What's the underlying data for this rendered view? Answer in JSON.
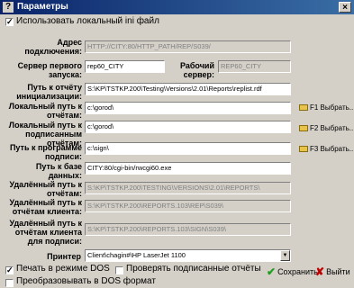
{
  "window": {
    "title": "Параметры",
    "close": "×",
    "app_icon": "?"
  },
  "use_ini": {
    "label": "Использовать локальный ini файл",
    "checked": true
  },
  "fields": {
    "address": {
      "label": "Адрес подключения:",
      "value": "HTTP://CITY:80/HTTP_PATH/REP/S039/"
    },
    "server_first": {
      "label": "Сервер первого запуска:",
      "value": "rep60_CITY"
    },
    "work_server": {
      "label": "Рабочий сервер:",
      "value": "REP60_CITY"
    },
    "init_path": {
      "label": "Путь к отчёту инициализации:",
      "value": "S:\\KP\\TSTKP.200\\Testing\\Versions\\2.01\\Reports\\replist.rdf"
    },
    "local_reports": {
      "label": "Локальный путь к отчётам:",
      "value": "c:\\gorod\\",
      "browse": "F1 Выбрать..."
    },
    "local_signed": {
      "label": "Локальный путь к подписанным отчётам:",
      "value": "c:\\gorod\\",
      "browse": "F2 Выбрать..."
    },
    "sign_program": {
      "label": "Путь к программе подписи:",
      "value": "c:\\sign\\",
      "browse": "F3 Выбрать..."
    },
    "db_path": {
      "label": "Путь к базе данных:",
      "value": "CITY:80/cgi-bin/rwcgi60.exe"
    },
    "remote_reports": {
      "label": "Удалённый путь к отчётам:",
      "value": "S:\\KP\\TSTKP.200\\TESTING\\VERSIONS\\2.01\\REPORTS\\"
    },
    "remote_client": {
      "label": "Удалённый путь к отчётам клиента:",
      "value": "S:\\KP\\TSTKP.200\\REPORTS.103\\REP\\S039\\"
    },
    "remote_client_sign": {
      "label": "Удалённый путь к отчётам клиента для подписи:",
      "value": "S:\\KP\\TSTKP.200\\REPORTS.103\\SIGN\\S039\\"
    },
    "printer": {
      "label": "Принтер",
      "value": "Client\\chagin#\\HP LaserJet 1100"
    }
  },
  "options": {
    "print_dos": {
      "label": "Печать в режиме DOS",
      "checked": true
    },
    "check_signed": {
      "label": "Проверять подписанные отчёты",
      "checked": false
    },
    "convert_dos": {
      "label": "Преобразовывать в DOS формат",
      "checked": false
    }
  },
  "buttons": {
    "save": "Сохранить",
    "exit": "Выйти"
  },
  "colors": {
    "titlebar": "#0a246a",
    "dialog": "#d4d0c8",
    "save_icon": "#1e9e1e",
    "exit_icon": "#c00000"
  }
}
